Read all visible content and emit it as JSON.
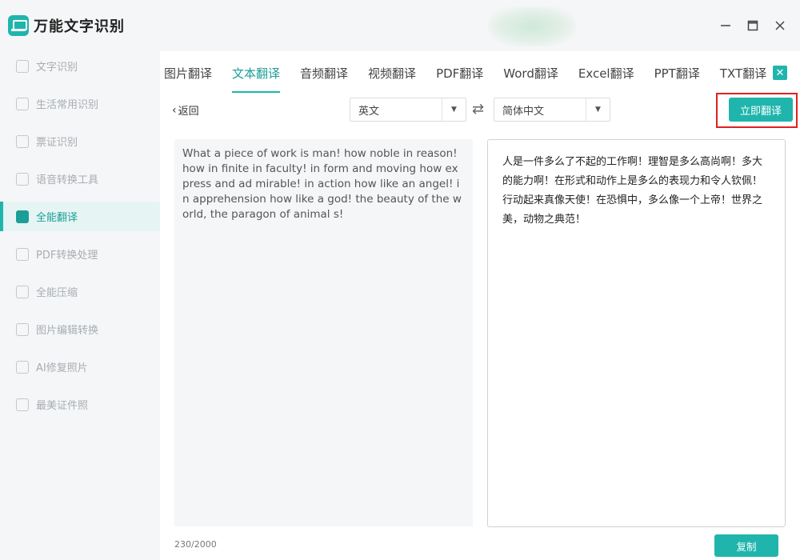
{
  "app": {
    "title": "万能文字识别",
    "accent": "#1fb5ad",
    "highlight_border": "#e02020"
  },
  "sidebar": {
    "items": [
      {
        "label": "文字识别",
        "icon": "scan-text-icon",
        "active": false
      },
      {
        "label": "生活常用识别",
        "icon": "scan-life-icon",
        "active": false
      },
      {
        "label": "票证识别",
        "icon": "ticket-scan-icon",
        "active": false
      },
      {
        "label": "语音转换工具",
        "icon": "voice-convert-icon",
        "active": false
      },
      {
        "label": "全能翻译",
        "icon": "translate-icon",
        "active": true
      },
      {
        "label": "PDF转换处理",
        "icon": "pdf-icon",
        "active": false
      },
      {
        "label": "全能压缩",
        "icon": "compress-icon",
        "active": false
      },
      {
        "label": "图片编辑转换",
        "icon": "image-edit-icon",
        "active": false
      },
      {
        "label": "AI修复照片",
        "icon": "ai-photo-icon",
        "active": false
      },
      {
        "label": "最美证件照",
        "icon": "id-photo-icon",
        "active": false
      }
    ]
  },
  "tabs": [
    {
      "label": "图片翻译",
      "active": false
    },
    {
      "label": "文本翻译",
      "active": true
    },
    {
      "label": "音频翻译",
      "active": false
    },
    {
      "label": "视频翻译",
      "active": false
    },
    {
      "label": "PDF翻译",
      "active": false
    },
    {
      "label": "Word翻译",
      "active": false
    },
    {
      "label": "Excel翻译",
      "active": false
    },
    {
      "label": "PPT翻译",
      "active": false
    },
    {
      "label": "TXT翻译",
      "active": false
    }
  ],
  "toolbar": {
    "back_label": "返回",
    "source_lang": "英文",
    "target_lang": "简体中文",
    "translate_label": "立即翻译"
  },
  "editor": {
    "source_text": "What a piece of work is man! how noble in reason! how in finite in faculty! in form and moving how express and ad mirable! in action how like an angel! in apprehension how like a god! the beauty of the world, the paragon of animal s!",
    "translated_text": "人是一件多么了不起的工作啊！理智是多么高尚啊！多大的能力啊！在形式和动作上是多么的表现力和令人钦佩！行动起来真像天使！在恐惧中，多么像一个上帝！世界之美，动物之典范！",
    "char_count": "230/2000",
    "copy_label": "复制"
  }
}
